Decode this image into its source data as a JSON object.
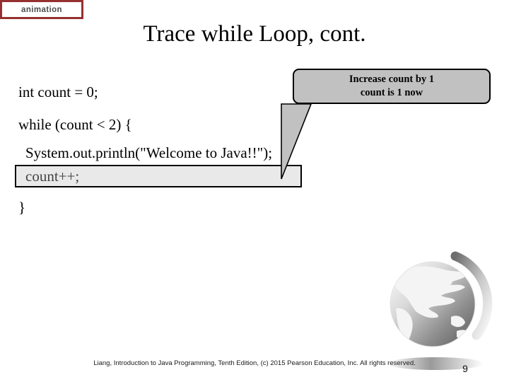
{
  "badge": {
    "label": "animation",
    "border_color": "#963030",
    "text_color": "#4d4d4d"
  },
  "title": "Trace while Loop, cont.",
  "code": {
    "line1": "int count = 0;",
    "line2": "while (count < 2) {",
    "line3": "System.out.println(\"Welcome to Java!!\");",
    "line4": "count++;",
    "line5": "}",
    "highlighted_line": "count++;",
    "highlight_fill": "#e9e9e9",
    "highlight_border": "#000000"
  },
  "callout": {
    "line1": "Increase count by 1",
    "line2": "count is 1 now",
    "fill": "#c1c1c1",
    "border": "#000000"
  },
  "graphic": {
    "globe_label": "globe-graphic"
  },
  "footer": {
    "credit": "Liang, Introduction to Java Programming, Tenth Edition, (c) 2015 Pearson Education, Inc. All rights reserved.",
    "page_number": "9"
  }
}
